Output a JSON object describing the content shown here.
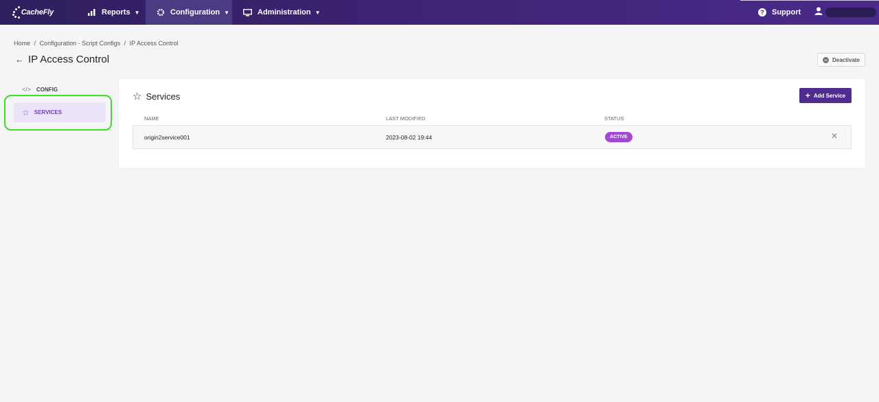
{
  "nav": {
    "logo_text": "CacheFly",
    "reports": "Reports",
    "configuration": "Configuration",
    "administration": "Administration",
    "support": "Support"
  },
  "breadcrumb": {
    "home": "Home",
    "sep": "/",
    "config_scripts": "Configuration - Script Configs",
    "current": "IP Access Control"
  },
  "page": {
    "title": "IP Access Control",
    "deactivate_label": "Deactivate"
  },
  "sidebar": {
    "items": [
      {
        "label": "CONFIG",
        "icon": "code-icon"
      },
      {
        "label": "SERVICES",
        "icon": "star-icon",
        "active": true
      }
    ]
  },
  "services": {
    "title": "Services",
    "add_label": "Add Service",
    "columns": [
      "NAME",
      "LAST MODIFIED",
      "STATUS"
    ],
    "rows": [
      {
        "name": "origin2service001",
        "last_modified": "2023-08-02 19:44",
        "status": "ACTIVE"
      }
    ]
  },
  "colors": {
    "nav_bg": "#3c2372",
    "accent": "#4f2d8f",
    "status_active": "#a348d6",
    "highlight_ring": "#3fdc23"
  }
}
